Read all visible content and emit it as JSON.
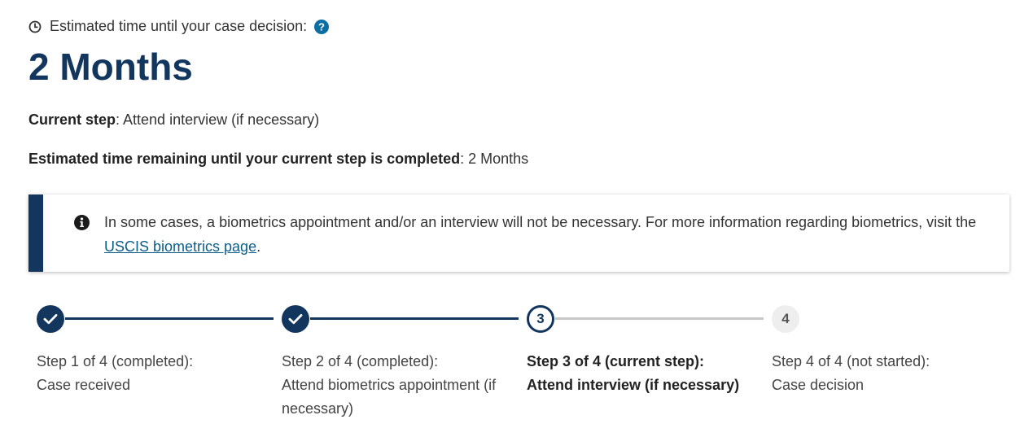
{
  "header": {
    "estimate_label": "Estimated time until your case decision:",
    "estimate_value": "2 Months"
  },
  "current_step": {
    "label": "Current step",
    "value": ": Attend interview (if necessary)"
  },
  "remaining": {
    "label": "Estimated time remaining until your current step is completed",
    "value": ": 2 Months"
  },
  "alert": {
    "text_before": "In some cases, a biometrics appointment and/or an interview will not be necessary. For more information regarding biometrics, visit the ",
    "link_text": "USCIS biometrics page",
    "text_after": "."
  },
  "steps": [
    {
      "marker": "",
      "status": "completed",
      "title": "Step 1 of 4 (completed):",
      "name": "Case received"
    },
    {
      "marker": "",
      "status": "completed",
      "title": "Step 2 of 4 (completed):",
      "name": "Attend biometrics appointment (if necessary)"
    },
    {
      "marker": "3",
      "status": "current",
      "title": "Step 3 of 4 (current step):",
      "name": "Attend interview (if necessary)"
    },
    {
      "marker": "4",
      "status": "not-started",
      "title": "Step 4 of 4 (not started):",
      "name": "Case decision"
    }
  ],
  "colors": {
    "primary": "#12365e",
    "link": "#0b5e8a",
    "pending_line": "#c8c8c8"
  },
  "icons": {
    "clock": "clock-icon",
    "help": "question-circle-icon",
    "info": "info-circle-icon",
    "check": "check-icon"
  }
}
